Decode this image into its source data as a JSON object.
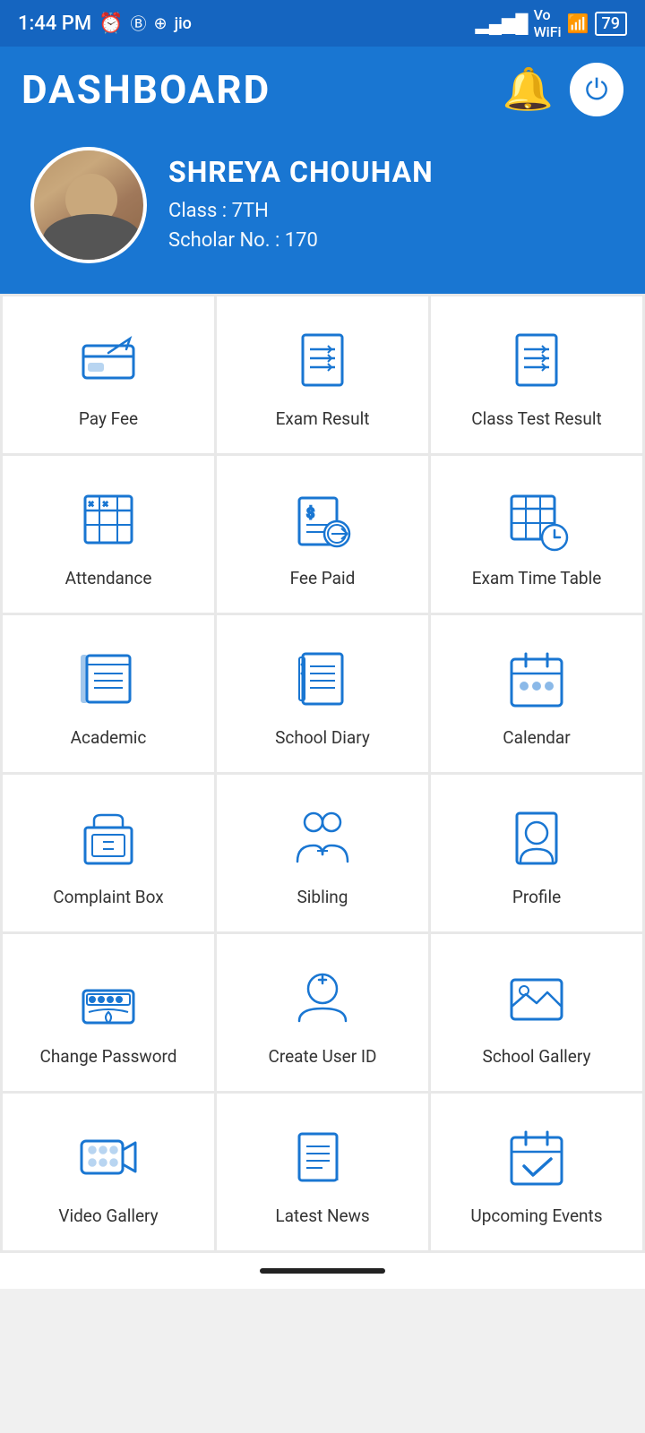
{
  "statusBar": {
    "time": "1:44 PM",
    "battery": "79"
  },
  "header": {
    "title": "DASHBOARD",
    "bellIcon": "bell-icon",
    "powerIcon": "power-icon"
  },
  "profile": {
    "name": "SHREYA  CHOUHAN",
    "classLabel": "Class : 7TH",
    "scholarLabel": "Scholar No. : 170"
  },
  "grid": {
    "items": [
      {
        "id": "pay-fee",
        "label": "Pay Fee",
        "icon": "credit-card"
      },
      {
        "id": "exam-result",
        "label": "Exam Result",
        "icon": "checklist"
      },
      {
        "id": "class-test-result",
        "label": "Class Test Result",
        "icon": "checklist2"
      },
      {
        "id": "attendance",
        "label": "Attendance",
        "icon": "attendance"
      },
      {
        "id": "fee-paid",
        "label": "Fee Paid",
        "icon": "fee-paid"
      },
      {
        "id": "exam-time-table",
        "label": "Exam Time Table",
        "icon": "timetable"
      },
      {
        "id": "academic",
        "label": "Academic",
        "icon": "academic"
      },
      {
        "id": "school-diary",
        "label": "School Diary",
        "icon": "diary"
      },
      {
        "id": "calendar",
        "label": "Calendar",
        "icon": "calendar"
      },
      {
        "id": "complaint-box",
        "label": "Complaint Box",
        "icon": "complaint"
      },
      {
        "id": "sibling",
        "label": "Sibling",
        "icon": "sibling"
      },
      {
        "id": "profile",
        "label": "Profile",
        "icon": "profile"
      },
      {
        "id": "change-password",
        "label": "Change Password",
        "icon": "change-password"
      },
      {
        "id": "create-user-id",
        "label": "Create User ID",
        "icon": "create-user"
      },
      {
        "id": "school-gallery",
        "label": "School Gallery",
        "icon": "gallery"
      },
      {
        "id": "video-gallery",
        "label": "Video Gallery",
        "icon": "video"
      },
      {
        "id": "latest-news",
        "label": "Latest News",
        "icon": "news"
      },
      {
        "id": "upcoming-events",
        "label": "Upcoming Events",
        "icon": "events"
      }
    ]
  }
}
